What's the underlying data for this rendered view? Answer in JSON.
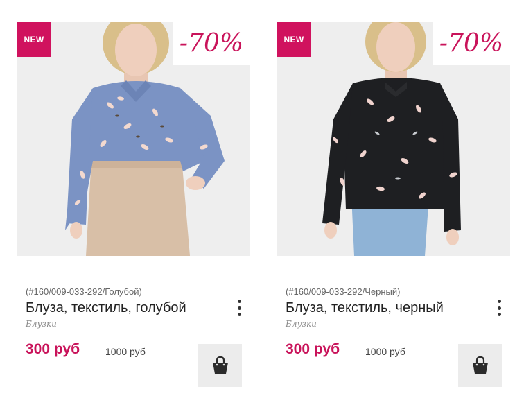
{
  "products": [
    {
      "badge_new": "NEW",
      "discount": "-70%",
      "sku": "(#160/009-033-292/Голубой)",
      "title": "Блуза, текстиль, голубой",
      "category": "Блузки",
      "price": "300 руб",
      "old_price": "1000 руб",
      "icons": [
        "more-vertical-icon",
        "shopping-bag-icon"
      ],
      "colors": {
        "blouse": "#7b93c4",
        "bottom": "#d8bfa7"
      }
    },
    {
      "badge_new": "NEW",
      "discount": "-70%",
      "sku": "(#160/009-033-292/Черный)",
      "title": "Блуза, текстиль, черный",
      "category": "Блузки",
      "price": "300 руб",
      "old_price": "1000 руб",
      "icons": [
        "more-vertical-icon",
        "shopping-bag-icon"
      ],
      "colors": {
        "blouse": "#1e1f22",
        "bottom": "#8fb3d6"
      }
    }
  ],
  "accent_color": "#c9135a"
}
